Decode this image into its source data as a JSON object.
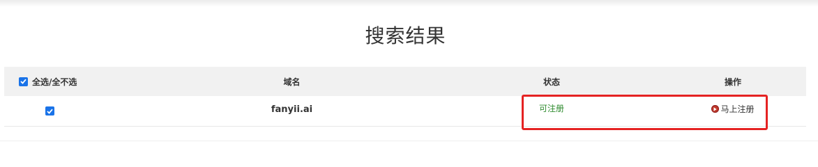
{
  "page": {
    "title": "搜索结果"
  },
  "table": {
    "headers": {
      "select_all": "全选/全不选",
      "domain": "域名",
      "status": "状态",
      "action": "操作"
    },
    "rows": [
      {
        "checked": true,
        "domain": "fanyii.ai",
        "status": "可注册",
        "action": "马上注册",
        "action_icon": "play-circle-icon"
      }
    ]
  },
  "colors": {
    "checkbox": "#1a73e8",
    "status_available": "#2e8b2e",
    "highlight": "#e52222",
    "action_icon": "#c0392b"
  }
}
